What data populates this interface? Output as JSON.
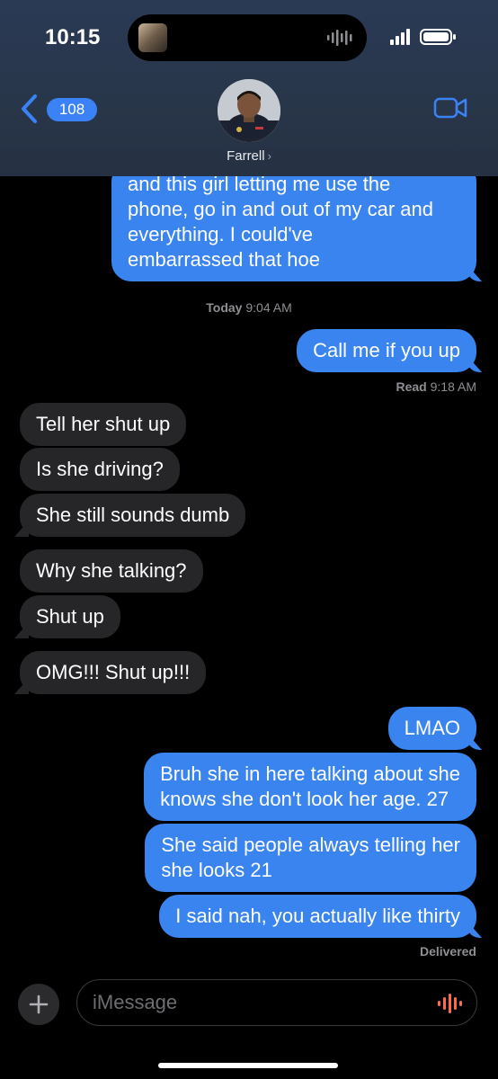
{
  "status_bar": {
    "time": "10:15"
  },
  "header": {
    "back_count": "108",
    "contact_name": "Farrell",
    "chevron": "›"
  },
  "icons": {
    "back": "chevron-left-icon",
    "video": "video-camera-icon",
    "plus": "plus-icon",
    "mic": "waveform-mic-icon",
    "signal": "cellular-signal-icon",
    "battery": "battery-icon"
  },
  "colors": {
    "sent_bubble": "#3a84f0",
    "received_bubble": "#262629",
    "accent": "#3b82f6"
  },
  "messages": [
    {
      "side": "sent",
      "lines": [
        "and this girl letting me use the",
        "phone, go in and out of my car and",
        "everything. I could've",
        "embarrassed that hoe"
      ]
    },
    {
      "side": "sent",
      "text": "Call me if you up"
    },
    {
      "side": "received",
      "text": "Tell her shut up"
    },
    {
      "side": "received",
      "text": "Is she driving?"
    },
    {
      "side": "received",
      "text": "She still sounds dumb"
    },
    {
      "side": "received",
      "text": "Why she talking?"
    },
    {
      "side": "received",
      "text": "Shut up"
    },
    {
      "side": "received",
      "text": "OMG!!! Shut up!!!"
    },
    {
      "side": "sent",
      "text": "LMAO"
    },
    {
      "side": "sent",
      "lines": [
        "Bruh she in here talking about she",
        "knows she don't look her age. 27"
      ]
    },
    {
      "side": "sent",
      "lines": [
        "She said people always telling her",
        "she looks 21"
      ]
    },
    {
      "side": "sent",
      "text": "I said nah, you actually like thirty"
    }
  ],
  "timestamps": {
    "day_label": "Today",
    "day_time": "9:04 AM",
    "read_label": "Read",
    "read_time": "9:18 AM",
    "delivered": "Delivered"
  },
  "compose": {
    "placeholder": "iMessage"
  }
}
